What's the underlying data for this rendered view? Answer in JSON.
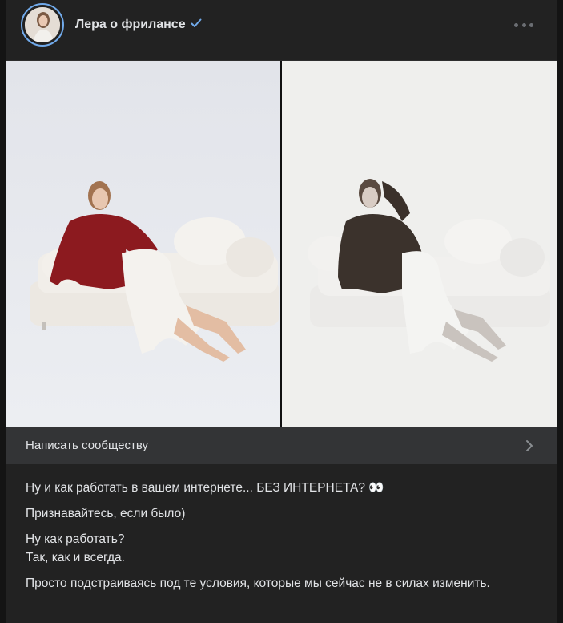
{
  "header": {
    "title": "Лера о фрилансе",
    "verified_icon": "verified-check-icon",
    "more_icon": "more-dots-icon"
  },
  "photos": {
    "left_alt": "woman in red coat on white sofa",
    "right_alt": "woman in dark coat on white sofa"
  },
  "cta": {
    "label": "Написать сообществу",
    "icon": "chevron-right-icon"
  },
  "post": {
    "p1": "Ну и как работать в вашем интернете... БЕЗ ИНТЕРНЕТА? 👀",
    "p2": "Признавайтесь, если было)",
    "p3_line1": "Ну как работать?",
    "p3_line2": "Так, как и всегда.",
    "p4": "Просто подстраиваясь под те условия, которые мы сейчас не в силах изменить."
  },
  "colors": {
    "background": "#141414",
    "card": "#222222",
    "text": "#e1e3e6",
    "accent": "#71aaeb",
    "cta_bg": "#333436"
  }
}
